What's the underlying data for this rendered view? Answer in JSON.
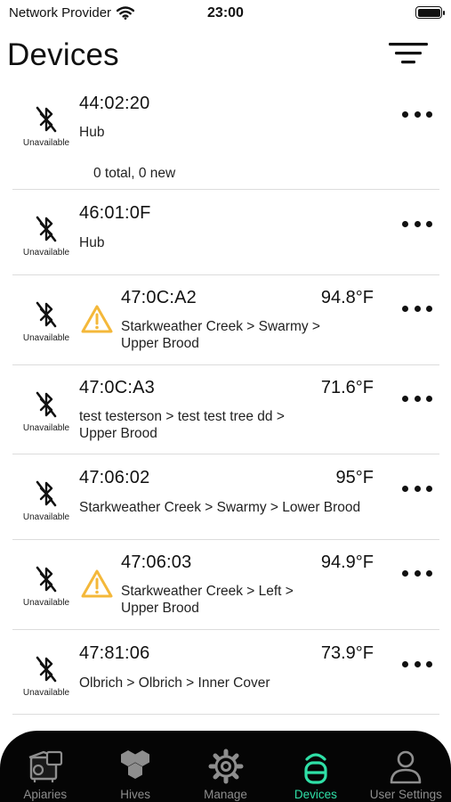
{
  "status_bar": {
    "carrier": "Network Provider",
    "time": "23:00"
  },
  "header": {
    "title": "Devices"
  },
  "devices": [
    {
      "id": "44:02:20",
      "subtitle": "Hub",
      "temperature": "",
      "status": "Unavailable",
      "warning": false,
      "count": "0 total, 0 new"
    },
    {
      "id": "46:01:0F",
      "subtitle": "Hub",
      "temperature": "",
      "status": "Unavailable",
      "warning": false,
      "count": ""
    },
    {
      "id": "47:0C:A2",
      "subtitle": "Starkweather Creek > Swarmy >\nUpper Brood",
      "temperature": "94.8°F",
      "status": "Unavailable",
      "warning": true,
      "count": ""
    },
    {
      "id": "47:0C:A3",
      "subtitle": "test testerson > test test tree dd >\nUpper Brood",
      "temperature": "71.6°F",
      "status": "Unavailable",
      "warning": false,
      "count": ""
    },
    {
      "id": "47:06:02",
      "subtitle": "Starkweather Creek > Swarmy > Lower Brood",
      "temperature": "95°F",
      "status": "Unavailable",
      "warning": false,
      "count": ""
    },
    {
      "id": "47:06:03",
      "subtitle": "Starkweather Creek > Left >\nUpper Brood",
      "temperature": "94.9°F",
      "status": "Unavailable",
      "warning": true,
      "count": ""
    },
    {
      "id": "47:81:06",
      "subtitle": "Olbrich > Olbrich > Inner Cover",
      "temperature": "73.9°F",
      "status": "Unavailable",
      "warning": false,
      "count": ""
    }
  ],
  "tabs": [
    {
      "label": "Apiaries",
      "icon": "apiary-icon",
      "active": false
    },
    {
      "label": "Hives",
      "icon": "hives-icon",
      "active": false
    },
    {
      "label": "Manage",
      "icon": "gear-icon",
      "active": false
    },
    {
      "label": "Devices",
      "icon": "devices-icon",
      "active": true
    },
    {
      "label": "User Settings",
      "icon": "user-icon",
      "active": false
    }
  ],
  "colors": {
    "accent": "#2fe0a7",
    "warning": "#f4b83a",
    "tab_bar": "#050505",
    "tab_inactive": "#8e8e8e"
  },
  "battery_level": 1.0
}
